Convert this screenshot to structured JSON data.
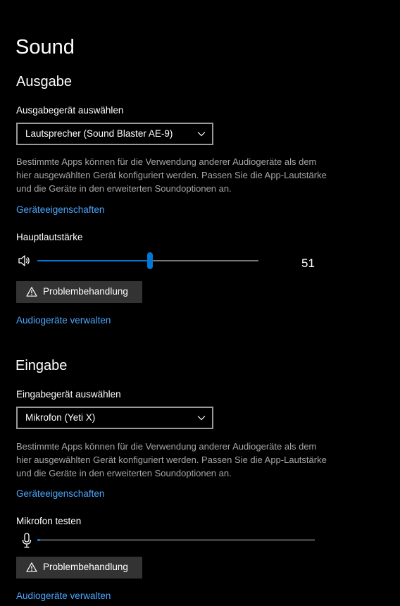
{
  "page": {
    "title": "Sound"
  },
  "output": {
    "heading": "Ausgabe",
    "device_label": "Ausgabegerät auswählen",
    "device_value": "Lautsprecher (Sound Blaster AE-9)",
    "description": "Bestimmte Apps können für die Verwendung anderer Audiogeräte als dem hier ausgewählten Gerät konfiguriert werden. Passen Sie die App-Lautstärke und die Geräte in den erweiterten Soundoptionen an.",
    "properties_link": "Geräteeigenschaften",
    "volume_label": "Hauptlautstärke",
    "volume_value": 51,
    "volume_value_text": "51",
    "troubleshoot_label": "Problembehandlung",
    "manage_link": "Audiogeräte verwalten",
    "icons": {
      "volume": "speaker-icon",
      "troubleshoot": "warning-icon",
      "dropdown": "chevron-down-icon"
    }
  },
  "input": {
    "heading": "Eingabe",
    "device_label": "Eingabegerät auswählen",
    "device_value": "Mikrofon (Yeti X)",
    "description": "Bestimmte Apps können für die Verwendung anderer Audiogeräte als dem hier ausgewählten Gerät konfiguriert werden. Passen Sie die App-Lautstärke und die Geräte in den erweiterten Soundoptionen an.",
    "properties_link": "Geräteeigenschaften",
    "test_label": "Mikrofon testen",
    "mic_level": 1,
    "troubleshoot_label": "Problembehandlung",
    "manage_link": "Audiogeräte verwalten",
    "icons": {
      "mic": "microphone-icon",
      "troubleshoot": "warning-icon",
      "dropdown": "chevron-down-icon"
    }
  },
  "colors": {
    "background": "#000000",
    "accent": "#0078d7",
    "link": "#4ca6ff",
    "secondary_text": "#a6a6a6",
    "button_bg": "#333333"
  }
}
